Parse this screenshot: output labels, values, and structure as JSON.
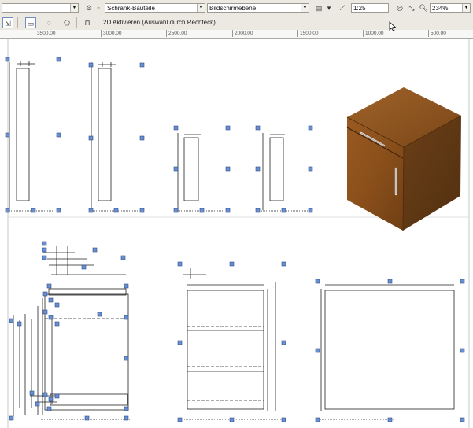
{
  "toolbar": {
    "layer_combo": "Schrank-Bauteile",
    "display_combo": "Bildschirmebene",
    "scale": "1:25",
    "zoom": "234%"
  },
  "status": {
    "message": "2D Aktivieren (Auswahl durch Rechteck)"
  },
  "ruler": {
    "ticks": [
      "3500.00",
      "3000.00",
      "2500.00",
      "2000.00",
      "1500.00",
      "1000.00",
      "500.00"
    ]
  },
  "icons": [
    "lock-icon",
    "layer-icon",
    "measure-icon",
    "magnet-icon",
    "zoom-icon",
    "select-icon",
    "rect-select-icon",
    "lasso-icon",
    "polygon-icon",
    "furniture-icon",
    "cursor-icon"
  ]
}
